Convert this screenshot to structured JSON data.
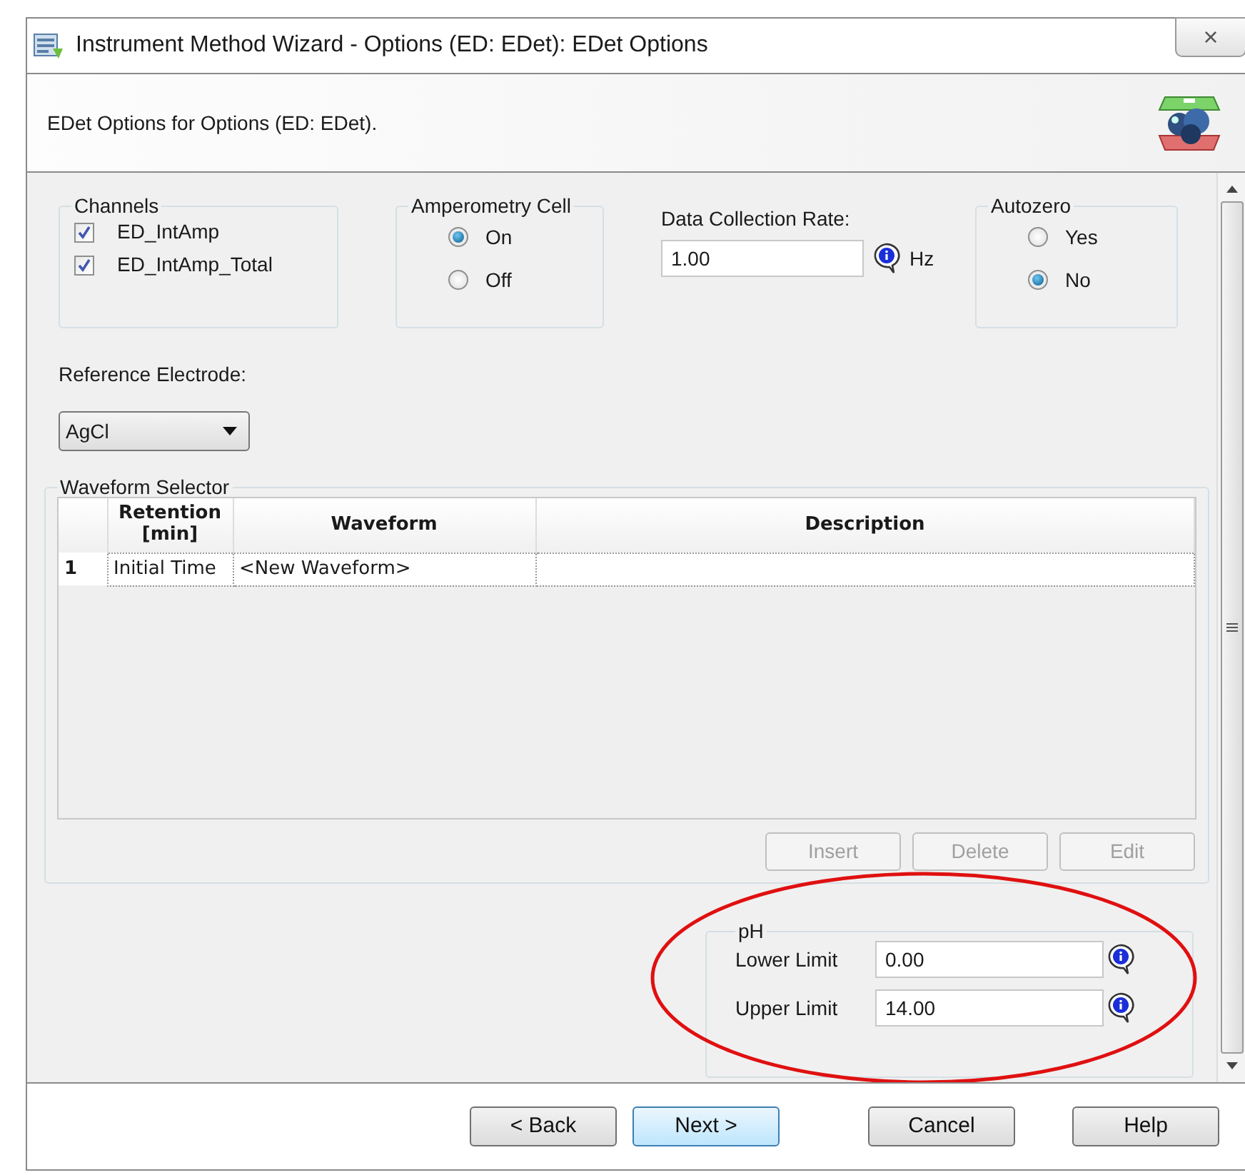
{
  "window": {
    "title": "Instrument Method Wizard - Options (ED: EDet): EDet Options",
    "close": "×"
  },
  "header": {
    "text": "EDet Options for Options (ED: EDet)."
  },
  "channels": {
    "legend": "Channels",
    "items": [
      {
        "label": "ED_IntAmp",
        "checked": true
      },
      {
        "label": "ED_IntAmp_Total",
        "checked": true
      }
    ]
  },
  "amperometry_cell": {
    "legend": "Amperometry Cell",
    "options": [
      {
        "label": "On",
        "selected": true
      },
      {
        "label": "Off",
        "selected": false
      }
    ]
  },
  "data_collection_rate": {
    "label": "Data Collection Rate:",
    "value": "1.00",
    "unit": "Hz"
  },
  "autozero": {
    "legend": "Autozero",
    "options": [
      {
        "label": "Yes",
        "selected": false
      },
      {
        "label": "No",
        "selected": true
      }
    ]
  },
  "reference_electrode": {
    "label": "Reference Electrode:",
    "value": "AgCl"
  },
  "waveform_selector": {
    "legend": "Waveform Selector",
    "columns": [
      "Retention\n[min]",
      "Waveform",
      "Description"
    ],
    "rows": [
      {
        "index": "1",
        "cells": [
          "Initial Time",
          "<New Waveform>",
          ""
        ]
      }
    ],
    "buttons": [
      {
        "label": "Insert",
        "disabled": true
      },
      {
        "label": "Delete",
        "disabled": true
      },
      {
        "label": "Edit",
        "disabled": true
      }
    ]
  },
  "ph": {
    "legend": "pH",
    "highlighted": true,
    "fields": [
      {
        "label": "Lower Limit",
        "value": "0.00"
      },
      {
        "label": "Upper Limit",
        "value": "14.00"
      }
    ]
  },
  "buttons": [
    {
      "label": "< Back",
      "selected": false
    },
    {
      "label": "Next >",
      "selected": true
    },
    {
      "label": "Cancel",
      "selected": false
    },
    {
      "label": "Help",
      "selected": false
    }
  ]
}
